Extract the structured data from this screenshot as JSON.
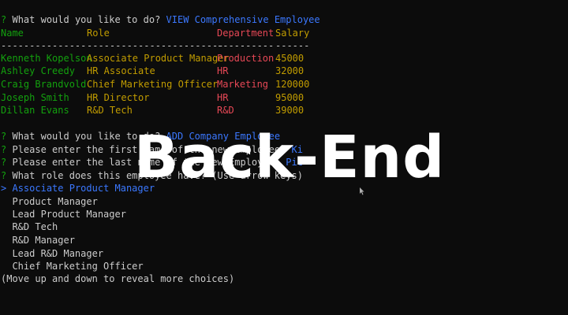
{
  "prompt_marker": "?",
  "select_marker": ">",
  "block1": {
    "question": "What would you like to do?",
    "answer": "VIEW Comprehensive Employee"
  },
  "table": {
    "headers": {
      "name": "Name",
      "role": "Role",
      "department": "Department",
      "salary": "Salary"
    },
    "separators": {
      "name": "---------------",
      "role": "------------------------",
      "department": "----------",
      "salary": "------"
    },
    "rows": [
      {
        "name": "Kenneth Kopelson",
        "role": "Associate Product Manager",
        "department": "Production",
        "salary": "45000"
      },
      {
        "name": "Ashley Creedy",
        "role": "HR Associate",
        "department": "HR",
        "salary": "32000"
      },
      {
        "name": "Craig Brandvold",
        "role": "Chief Marketing Officer",
        "department": "Marketing",
        "salary": "120000"
      },
      {
        "name": "Joseph Smith",
        "role": "HR Director",
        "department": "HR",
        "salary": "95000"
      },
      {
        "name": "Dillan Evans",
        "role": "R&D Tech",
        "department": "R&D",
        "salary": "39000"
      }
    ]
  },
  "block2": {
    "q1": "What would you like to do?",
    "a1": "ADD Company Employee",
    "q2": "Please enter the first name of the new Employee:",
    "a2": "Ki",
    "q3": "Please enter the last name of the new Employee:",
    "a3": "Pic",
    "q4": "What role does this employee have? (Use arrow keys)"
  },
  "choices": {
    "selected": "Associate Product Manager",
    "others": [
      "Product Manager",
      "Lead Product Manager",
      "R&D Tech",
      "R&D Manager",
      "Lead R&D Manager",
      "Chief Marketing Officer"
    ],
    "hint": "(Move up and down to reveal more choices)"
  },
  "overlay_title": "Back-End",
  "colors": {
    "background": "#0c0c0c",
    "prompt_green": "#13a10e",
    "answer_blue": "#3b78ff",
    "header_yellow": "#c19c00",
    "dept_red": "#e74856",
    "overlay_white": "#ffffff"
  }
}
